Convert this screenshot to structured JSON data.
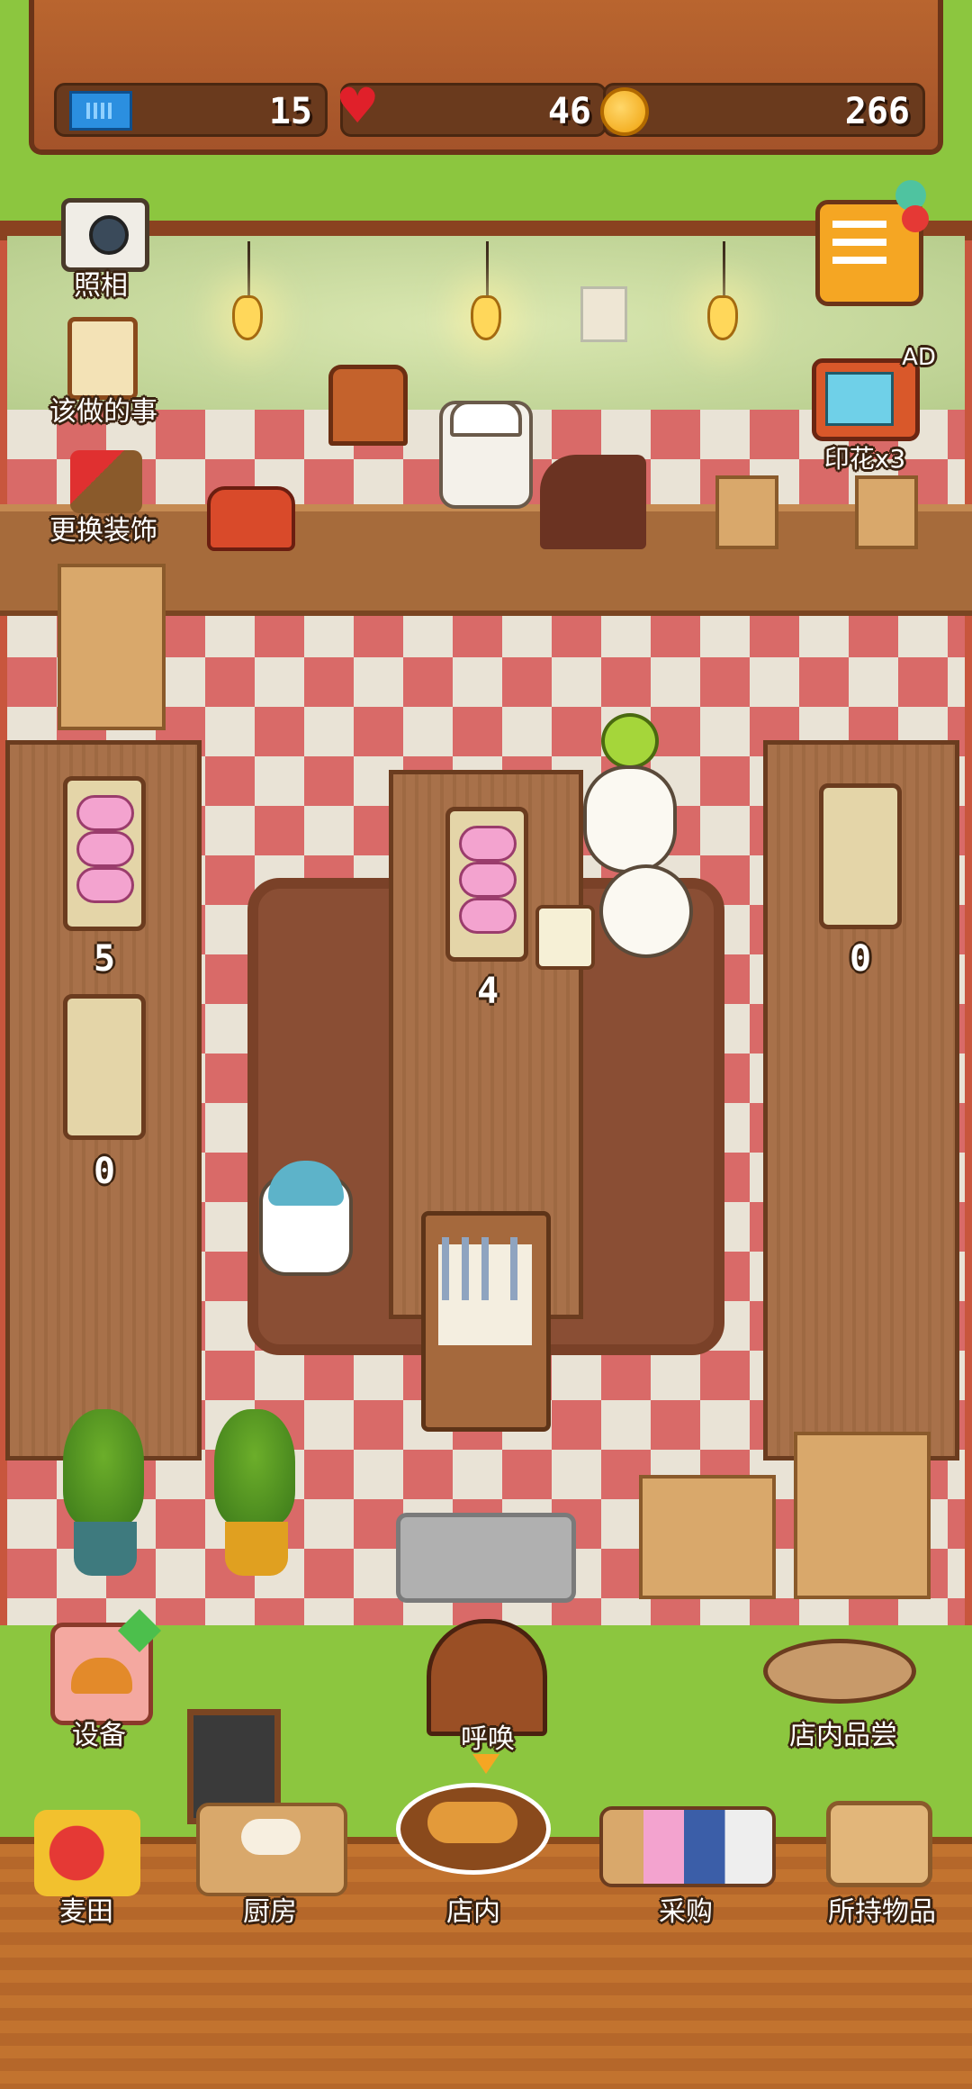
{
  "status": {
    "tickets": "15",
    "hearts": "46",
    "coins": "266"
  },
  "left_menu": {
    "photo": "照相",
    "todo": "该做的事",
    "decor": "更换装饰"
  },
  "ad": {
    "badge": "AD",
    "label": "印花x3"
  },
  "display_counts": [
    "5",
    "0",
    "4",
    "0"
  ],
  "floor_actions": {
    "equipment": "设备",
    "call": "呼唤",
    "tasting": "店内品尝"
  },
  "nav": {
    "wheat_field": "麦田",
    "kitchen": "厨房",
    "shop": "店内",
    "purchase": "采购",
    "inventory": "所持物品"
  },
  "colors": {
    "accent": "#8cc63f",
    "wood": "#a66b3b",
    "heart": "#e0202a",
    "coin": "#f0a10a",
    "ticket": "#2b8fe0"
  },
  "icons": [
    "ticket-icon",
    "heart-icon",
    "coin-icon",
    "camera-icon",
    "clipboard-icon",
    "brush-icon",
    "tv-icon",
    "bread-basket-icon",
    "door-icon",
    "tasting-plate-icon",
    "wheat-icon",
    "kitchen-icon",
    "shop-bread-icon",
    "shelf-icon",
    "box-icon"
  ]
}
